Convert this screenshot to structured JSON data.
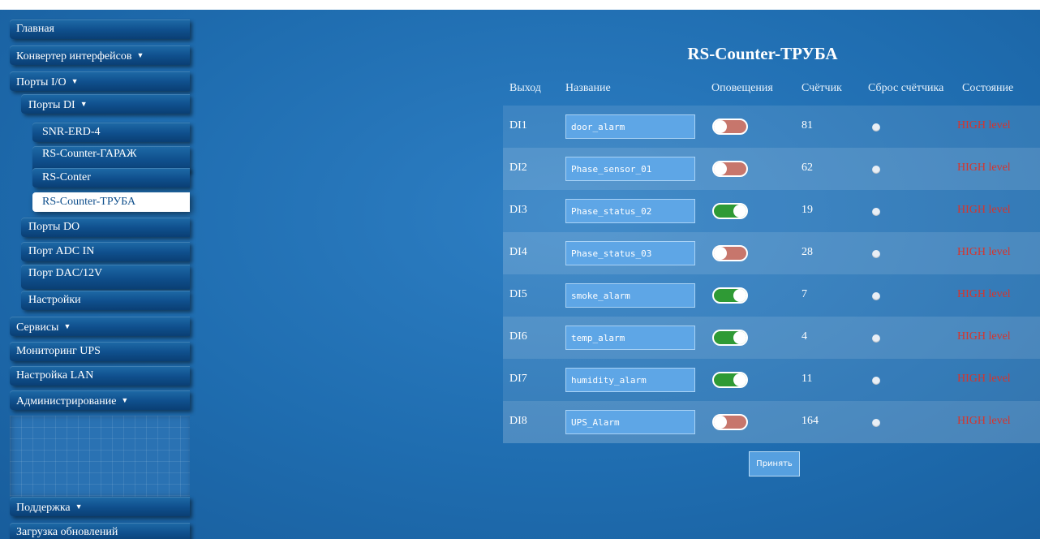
{
  "sidebar": {
    "items": [
      {
        "label": "Главная",
        "caret": ""
      },
      {
        "label": "Конвертер интерфейсов",
        "caret": "▼"
      },
      {
        "label": "Порты I/O",
        "caret": "▼"
      },
      {
        "label": "Порты DI",
        "caret": "▼"
      },
      {
        "label": "SNR-ERD-4",
        "caret": ""
      },
      {
        "label": "RS-Counter-ГАРАЖ",
        "caret": ""
      },
      {
        "label": "RS-Conter",
        "caret": ""
      },
      {
        "label": "RS-Counter-ТРУБА",
        "caret": ""
      },
      {
        "label": "Порты DO",
        "caret": ""
      },
      {
        "label": "Порт ADC IN",
        "caret": ""
      },
      {
        "label": "Порт DAC/12V",
        "caret": ""
      },
      {
        "label": "Настройки",
        "caret": ""
      },
      {
        "label": "Сервисы",
        "caret": "▼"
      },
      {
        "label": "Мониторинг UPS",
        "caret": ""
      },
      {
        "label": "Настройка LAN",
        "caret": ""
      },
      {
        "label": "Администрирование",
        "caret": "▼"
      },
      {
        "label": "Поддержка",
        "caret": "▼"
      },
      {
        "label": "Загрузка обновлений",
        "caret": ""
      }
    ],
    "active_item": "RS-Counter-ТРУБА"
  },
  "page": {
    "title": "RS-Counter-ТРУБА",
    "accept_label": "Принять"
  },
  "table": {
    "headers": {
      "output": "Выход",
      "name": "Название",
      "alerts": "Оповещения",
      "counter": "Счётчик",
      "reset": "Сброс счётчика",
      "state": "Состояние"
    },
    "rows": [
      {
        "output": "DI1",
        "name": "door_alarm",
        "alert_on": false,
        "counter": "81",
        "state": "HIGH level"
      },
      {
        "output": "DI2",
        "name": "Phase_sensor_01",
        "alert_on": false,
        "counter": "62",
        "state": "HIGH level"
      },
      {
        "output": "DI3",
        "name": "Phase_status_02",
        "alert_on": true,
        "counter": "19",
        "state": "HIGH level"
      },
      {
        "output": "DI4",
        "name": "Phase_status_03",
        "alert_on": false,
        "counter": "28",
        "state": "HIGH level"
      },
      {
        "output": "DI5",
        "name": "smoke_alarm",
        "alert_on": true,
        "counter": "7",
        "state": "HIGH level"
      },
      {
        "output": "DI6",
        "name": "temp_alarm",
        "alert_on": true,
        "counter": "4",
        "state": "HIGH level"
      },
      {
        "output": "DI7",
        "name": "humidity_alarm",
        "alert_on": true,
        "counter": "11",
        "state": "HIGH level"
      },
      {
        "output": "DI8",
        "name": "UPS_Alarm",
        "alert_on": false,
        "counter": "164",
        "state": "HIGH level"
      }
    ]
  },
  "colors": {
    "toggle_on": "#2f9a35",
    "toggle_off": "#c7766c",
    "state_high": "#d9332a"
  }
}
